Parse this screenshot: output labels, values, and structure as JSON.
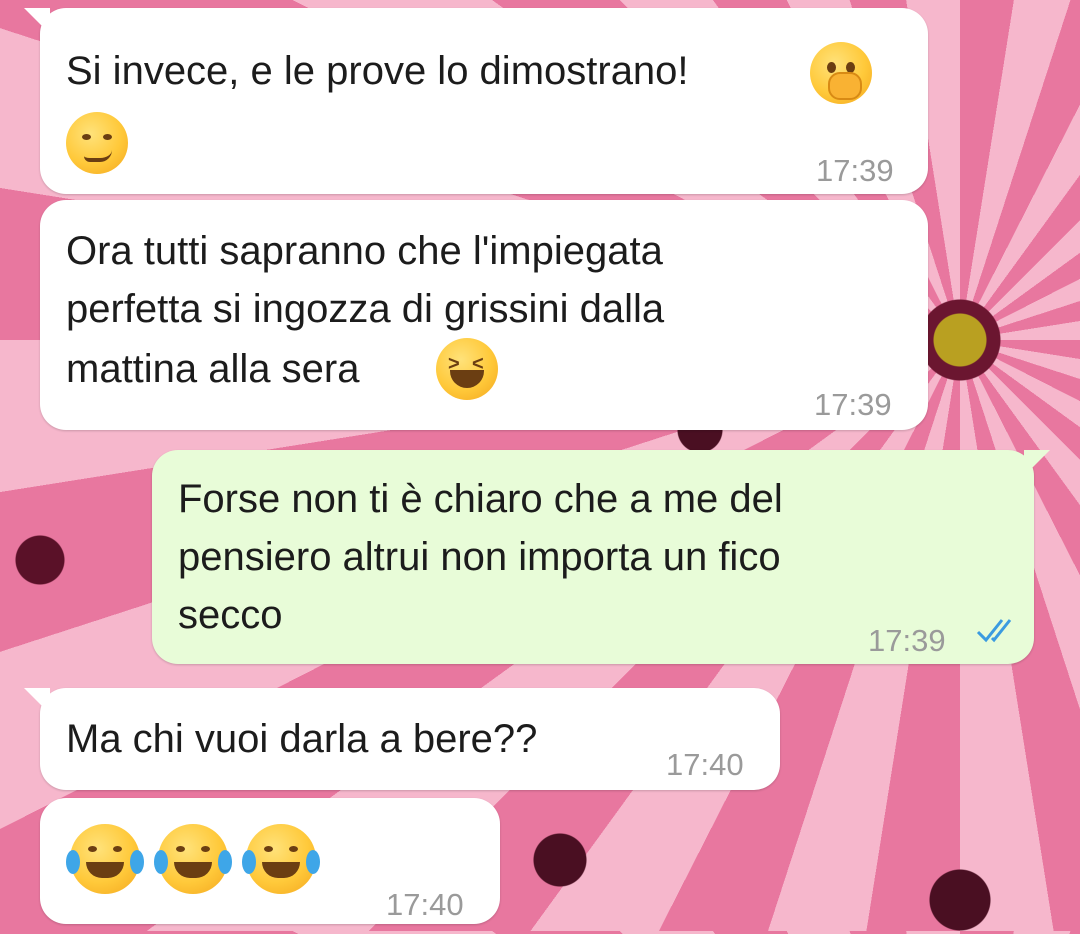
{
  "messages": [
    {
      "direction": "incoming",
      "lines": [
        "Si invece, e le prove lo dimostrano!"
      ],
      "emojis": [
        "face-with-hand-over-mouth-emoji",
        "smirking-face-emoji"
      ],
      "time": "17:39"
    },
    {
      "direction": "incoming",
      "lines": [
        "Ora tutti sapranno che l'impiegata",
        "perfetta si ingozza di grissini dalla",
        "mattina alla sera"
      ],
      "emojis": [
        "grinning-squinting-face-emoji"
      ],
      "time": "17:39"
    },
    {
      "direction": "outgoing",
      "lines": [
        "Forse non ti è chiaro che a me del",
        "pensiero altrui non importa un fico",
        "secco"
      ],
      "time": "17:39",
      "status": "read",
      "status_icon": "double-check-icon"
    },
    {
      "direction": "incoming",
      "lines": [
        "Ma chi vuoi darla a bere??"
      ],
      "time": "17:40"
    },
    {
      "direction": "incoming",
      "lines": [],
      "emojis": [
        "tears-of-joy-emoji",
        "tears-of-joy-emoji",
        "tears-of-joy-emoji"
      ],
      "time": "17:40"
    }
  ],
  "colors": {
    "incoming_bubble": "#ffffff",
    "outgoing_bubble": "#e8fcd8",
    "timestamp": "#9a9a9a",
    "read_ticks": "#3b9be0"
  }
}
